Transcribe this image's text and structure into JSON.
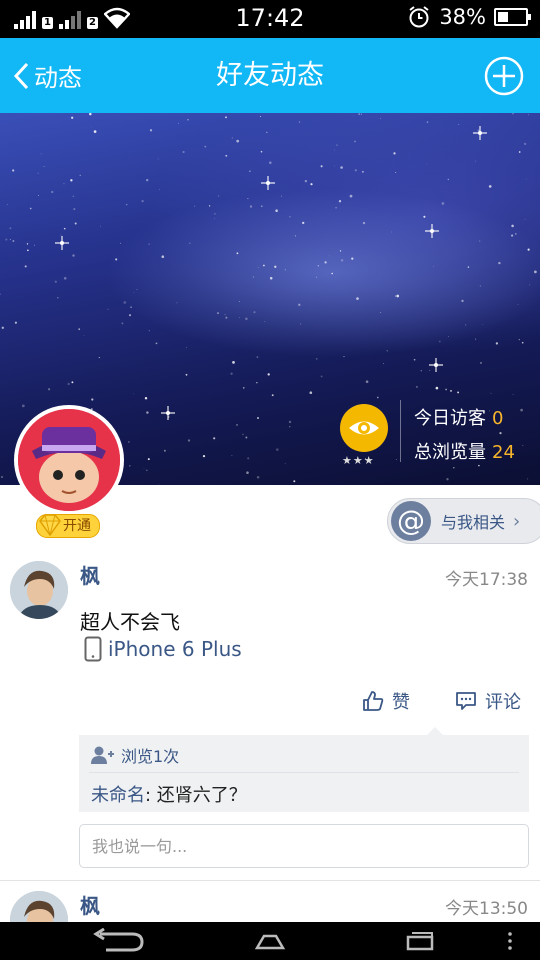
{
  "status_bar": {
    "time": "17:42",
    "battery_percent_label": "38%",
    "battery_level": 0.38,
    "sim1_label": "1",
    "sim2_label": "2",
    "icons": [
      "signal-icon",
      "wifi-icon",
      "alarm-icon",
      "battery-icon"
    ]
  },
  "nav": {
    "back_label": "动态",
    "title": "好友动态",
    "add_icon": "plus-circle-icon"
  },
  "cover": {
    "visitors_today_label": "今日访客",
    "visitors_today_value": "0",
    "total_views_label": "总浏览量",
    "total_views_value": "24",
    "eye_stars": "★★★",
    "vip_label": "开通"
  },
  "mention": {
    "label": "与我相关",
    "icon": "at-icon"
  },
  "posts": [
    {
      "author": "枫",
      "time": "今天17:38",
      "text": "超人不会飞",
      "device": "iPhone 6 Plus",
      "like_label": "赞",
      "comment_label": "评论",
      "views_label": "浏览1次",
      "comments": [
        {
          "author": "未命名",
          "text": ": 还肾六了？"
        }
      ],
      "reply_placeholder": "我也说一句..."
    },
    {
      "author": "枫",
      "time": "今天13:50"
    }
  ],
  "colors": {
    "nav_bg": "#12b7f5",
    "link": "#3a5786",
    "stat_number": "#f7b52c",
    "vip": "#fdd23a"
  }
}
